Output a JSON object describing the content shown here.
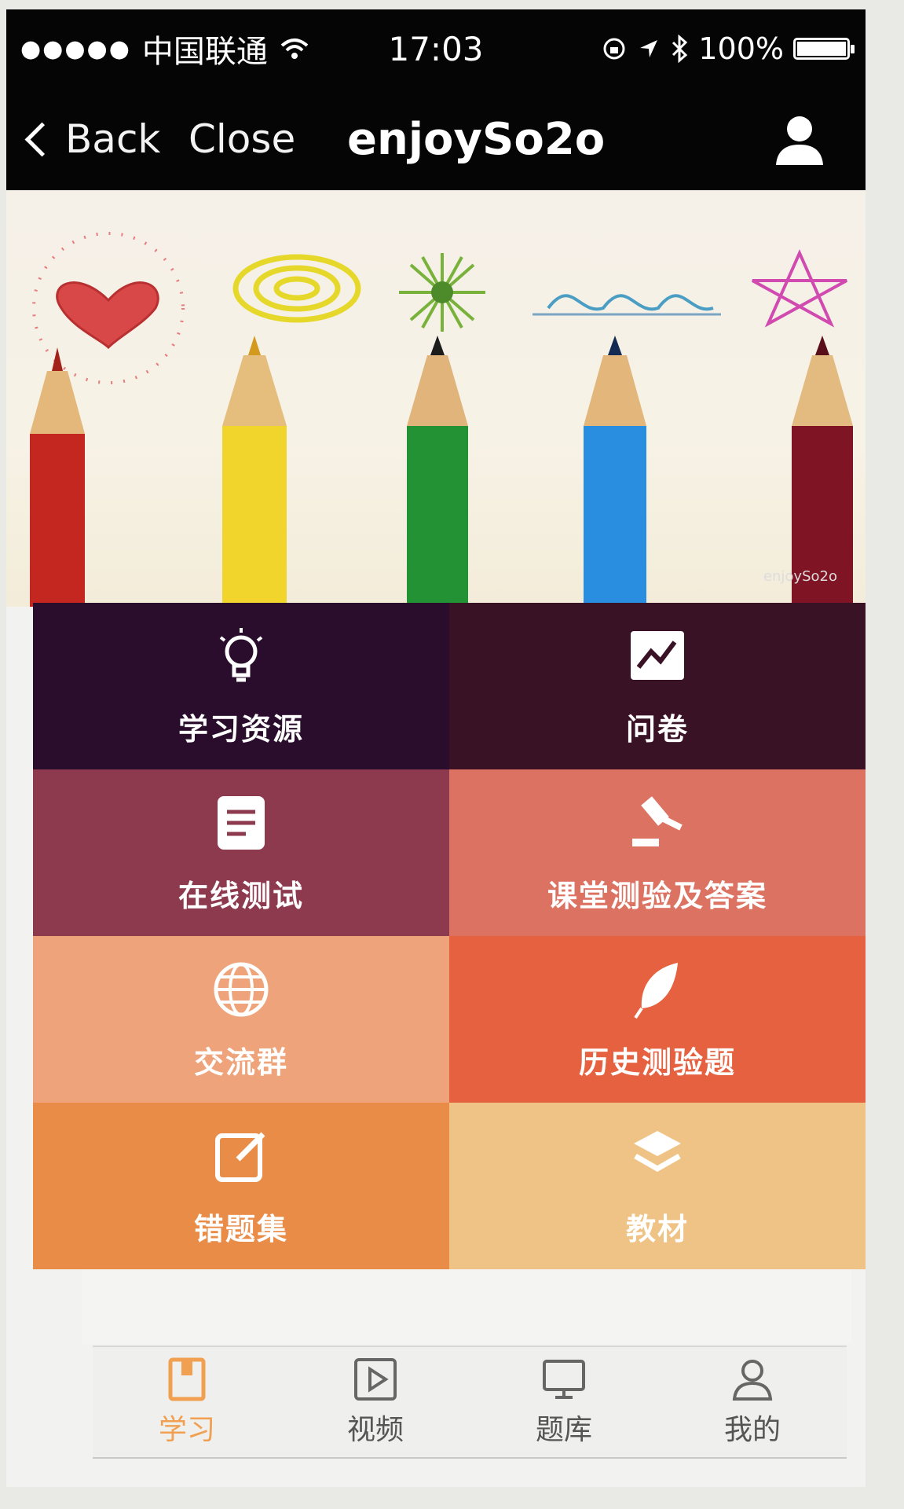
{
  "status_bar": {
    "signal_dots": "●●●●●",
    "carrier": "中国联通",
    "time": "17:03",
    "battery_percent": "100%"
  },
  "nav": {
    "back_label": "Back",
    "close_label": "Close",
    "title": "enjoySo2o"
  },
  "banner": {
    "watermark": "enjoySo2o"
  },
  "tiles": [
    {
      "label": "学习资源",
      "icon": "lightbulb-icon",
      "color": "#2a0d2c"
    },
    {
      "label": "问卷",
      "icon": "chart-icon",
      "color": "#3a1226"
    },
    {
      "label": "在线测试",
      "icon": "document-icon",
      "color": "#8e3a4e"
    },
    {
      "label": "课堂测验及答案",
      "icon": "gavel-icon",
      "color": "#dc7262"
    },
    {
      "label": "交流群",
      "icon": "globe-icon",
      "color": "#eea37a"
    },
    {
      "label": "历史测验题",
      "icon": "feather-icon",
      "color": "#e5613f"
    },
    {
      "label": "错题集",
      "icon": "edit-icon",
      "color": "#e88c48"
    },
    {
      "label": "教材",
      "icon": "layers-icon",
      "color": "#efc385"
    }
  ],
  "tabbar": {
    "items": [
      {
        "label": "学习",
        "icon": "book-icon",
        "active": true
      },
      {
        "label": "视频",
        "icon": "video-icon",
        "active": false
      },
      {
        "label": "题库",
        "icon": "monitor-icon",
        "active": false
      },
      {
        "label": "我的",
        "icon": "person-icon",
        "active": false
      }
    ]
  },
  "colors": {
    "bar_bg": "#050505",
    "active_tab": "#f0a050"
  }
}
